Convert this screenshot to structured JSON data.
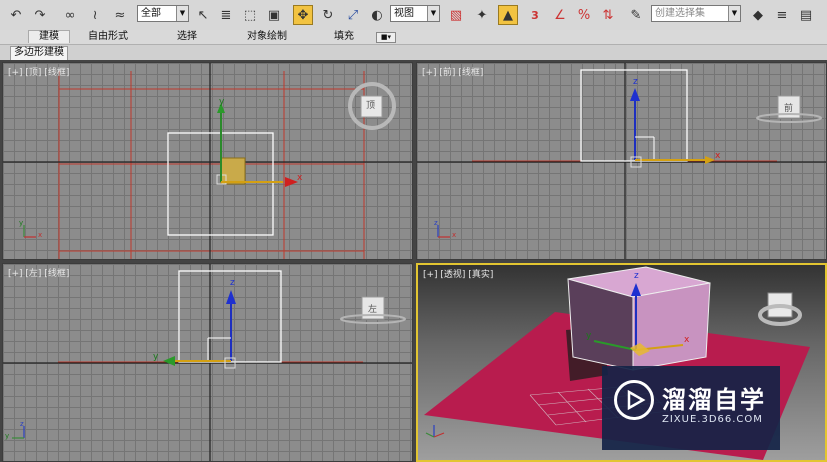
{
  "toolbar": {
    "selection_filter": "全部",
    "ref_coord": "视图",
    "snap_3": "3",
    "named_selection_placeholder": "创建选择集"
  },
  "ribbon": {
    "tabs": [
      "建模",
      "自由形式",
      "选择",
      "对象绘制",
      "填充"
    ],
    "sub_tab": "多边形建模"
  },
  "viewports": {
    "top": {
      "label": "[+] [顶] [线框]",
      "viewcube": "顶"
    },
    "front": {
      "label": "[+] [前] [线框]",
      "viewcube": "前"
    },
    "left": {
      "label": "[+] [左] [线框]",
      "viewcube": "左"
    },
    "perspective": {
      "label": "[+] [透视] [真实]"
    }
  },
  "axes": {
    "x": "x",
    "y": "y",
    "z": "z"
  },
  "watermark": {
    "title": "溜溜自学",
    "url": "ZIXUE.3D66.COM"
  },
  "colors": {
    "active_border": "#e2c531",
    "plane_red": "#b81c4e",
    "box_pink": "#d8a0cd",
    "grid_line": "#c0392b"
  }
}
